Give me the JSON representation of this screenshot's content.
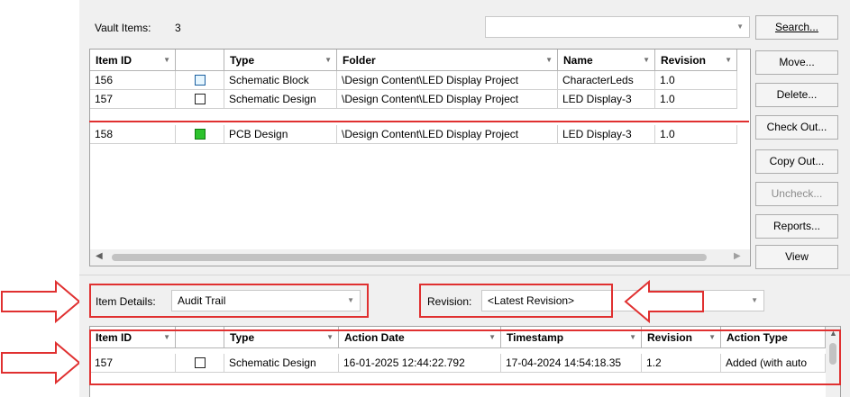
{
  "vault": {
    "items_label": "Vault Items:",
    "items_count": "3",
    "columns": [
      "Item ID",
      "",
      "Type",
      "Folder",
      "Name",
      "Revision"
    ],
    "rows": [
      {
        "id": "156",
        "icon": "schematic-block-icon",
        "type": "Schematic Block",
        "folder": "\\Design Content\\LED Display Project",
        "name": "CharacterLeds",
        "revision": "1.0"
      },
      {
        "id": "157",
        "icon": "schematic-design-icon",
        "type": "Schematic Design",
        "folder": "\\Design Content\\LED Display Project",
        "name": "LED Display-3",
        "revision": "1.0"
      },
      {
        "id": "158",
        "icon": "pcb-design-icon",
        "type": "PCB Design",
        "folder": "\\Design Content\\LED Display Project",
        "name": "LED Display-3",
        "revision": "1.0"
      }
    ]
  },
  "buttons": {
    "search": "Search...",
    "move": "Move...",
    "delete": "Delete...",
    "checkout": "Check Out...",
    "copyout": "Copy Out...",
    "uncheck": "Uncheck...",
    "reports": "Reports...",
    "view": "View"
  },
  "details": {
    "item_details_label": "Item Details:",
    "item_details_value": "Audit Trail",
    "revision_label": "Revision:",
    "revision_value": "<Latest Revision>",
    "columns": [
      "Item ID",
      "",
      "Type",
      "Action Date",
      "Timestamp",
      "Revision",
      "Action Type"
    ],
    "rows": [
      {
        "id": "157",
        "icon": "schematic-design-icon",
        "type": "Schematic Design",
        "action_date": "16-01-2025 12:44:22.792",
        "timestamp": "17-04-2024 14:54:18.35",
        "revision": "1.2",
        "action_type": "Added (with auto"
      }
    ]
  },
  "colors": {
    "annotation": "#e03030",
    "panel_bg": "#f0f0f0"
  }
}
